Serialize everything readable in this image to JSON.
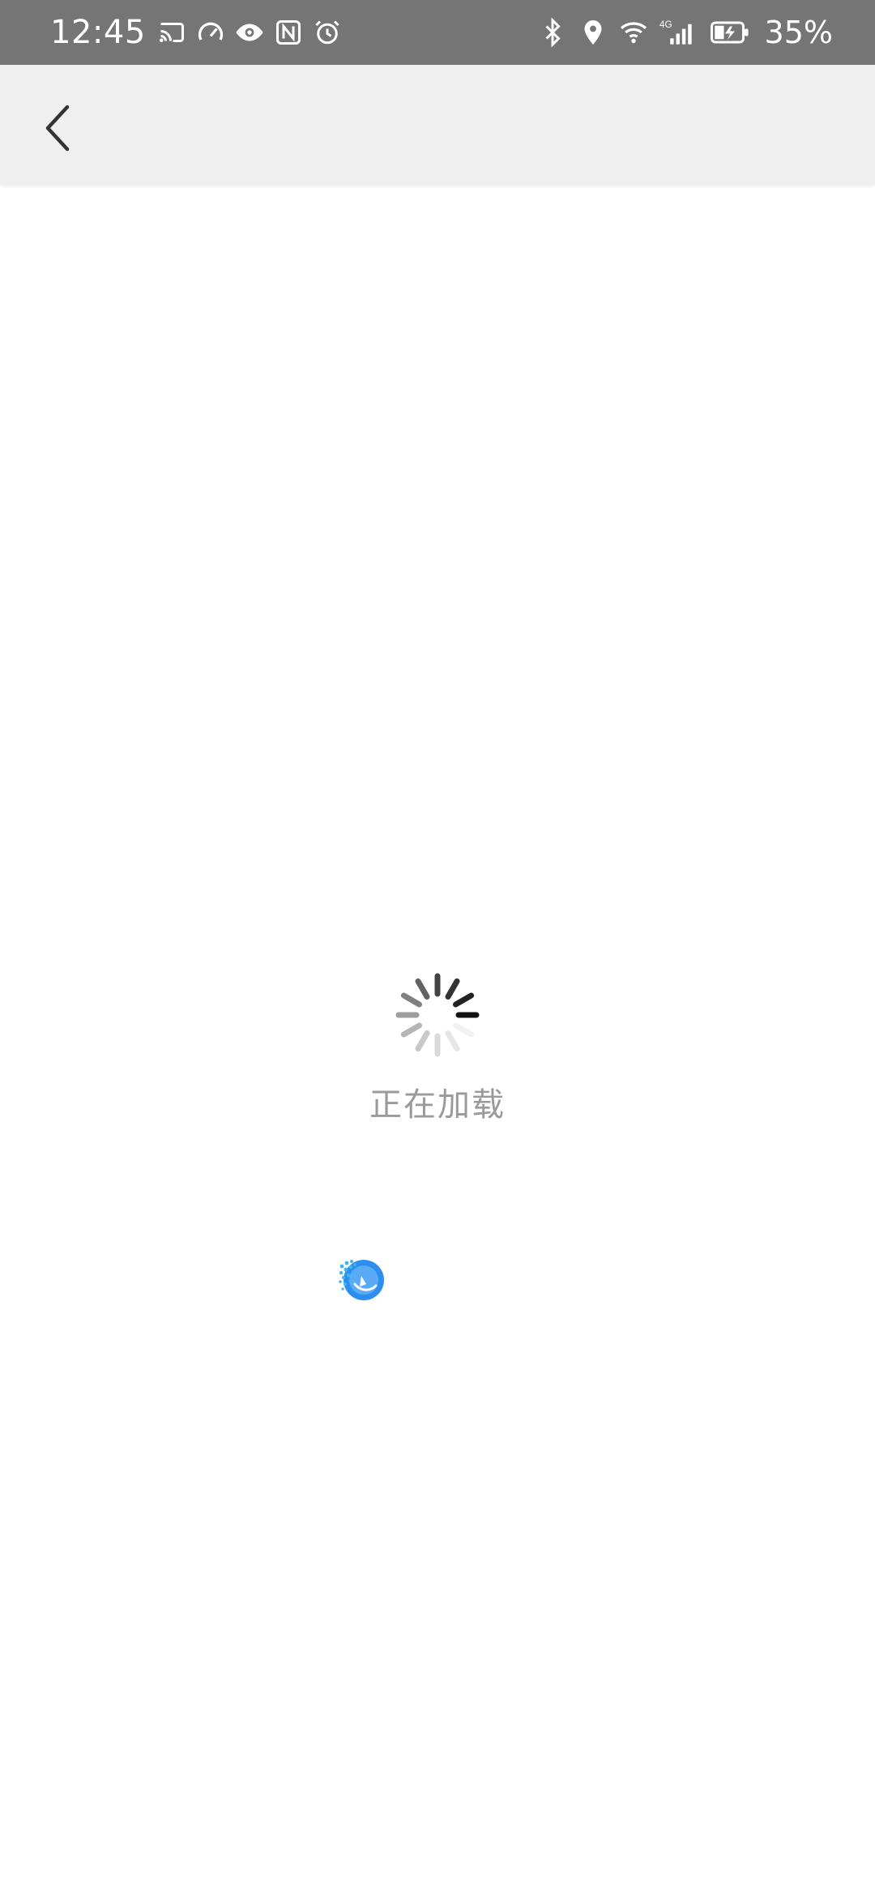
{
  "status_bar": {
    "time": "12:45",
    "left_icons": [
      "cast-icon",
      "speedometer-icon",
      "eye-icon",
      "nfc-icon",
      "alarm-icon"
    ],
    "right_icons": [
      "bluetooth-icon",
      "location-icon",
      "wifi-icon",
      "signal-4g-icon",
      "battery-charging-icon"
    ],
    "network_label": "4G",
    "battery_percent": "35%",
    "background_color": "#757575"
  },
  "app_bar": {
    "back_icon": "chevron-left-icon",
    "background_color": "#efefef"
  },
  "loading": {
    "text": "正在加载",
    "spinner_icon": "loading-spinner-icon"
  },
  "logo": {
    "icon": "app-logo-icon",
    "color": "#2e8ef0"
  }
}
